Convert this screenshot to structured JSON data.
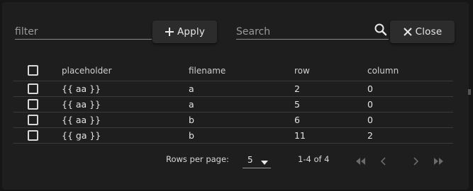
{
  "toolbar": {
    "filter_placeholder": "filter",
    "apply_label": "Apply",
    "search_placeholder": "Search",
    "close_label": "Close"
  },
  "table": {
    "columns": [
      "placeholder",
      "filename",
      "row",
      "column"
    ],
    "rows": [
      {
        "placeholder": "{{ aa }}",
        "filename": "a",
        "row": "2",
        "column": "0"
      },
      {
        "placeholder": "{{ aa }}",
        "filename": "a",
        "row": "5",
        "column": "0"
      },
      {
        "placeholder": "{{ aa }}",
        "filename": "b",
        "row": "6",
        "column": "0"
      },
      {
        "placeholder": "{{ ga }}",
        "filename": "b",
        "row": "11",
        "column": "2"
      }
    ]
  },
  "pagination": {
    "rows_per_page_label": "Rows per page:",
    "rows_per_page_value": "5",
    "range_label": "1-4 of 4"
  },
  "icons": {
    "apply": "plus-icon",
    "search": "search-icon",
    "close": "close-icon",
    "first": "first-page-icon",
    "prev": "chevron-left-icon",
    "next": "chevron-right-icon",
    "last": "last-page-icon",
    "dropdown": "caret-down-icon"
  },
  "colors": {
    "background": "#1e1e1e",
    "button": "#2c2c2c",
    "text": "#e6e6e6",
    "divider": "#3a3a3a",
    "disabled": "#6a6a6a"
  }
}
